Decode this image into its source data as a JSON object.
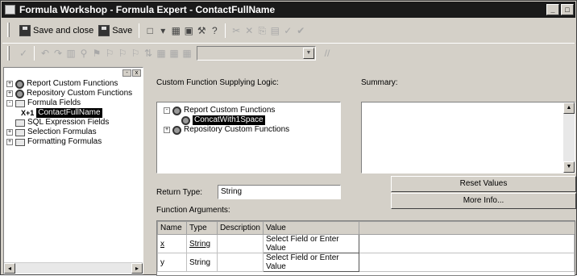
{
  "window": {
    "title": "Formula Workshop - Formula Expert - ContactFullName"
  },
  "toolbar": {
    "save_close_label": "Save and close",
    "save_label": "Save",
    "comment_label": "//"
  },
  "tree": {
    "items": [
      {
        "label": "Report Custom Functions",
        "expander": "+"
      },
      {
        "label": "Repository Custom Functions",
        "expander": "+"
      },
      {
        "label": "Formula Fields",
        "expander": "-"
      },
      {
        "label": "ContactFullName",
        "prefix": "X+1"
      },
      {
        "label": "SQL Expression Fields",
        "expander": ""
      },
      {
        "label": "Selection Formulas",
        "expander": "+"
      },
      {
        "label": "Formatting Formulas",
        "expander": "+"
      }
    ]
  },
  "logic": {
    "label": "Custom Function Supplying Logic:",
    "items": [
      {
        "label": "Report Custom Functions",
        "expander": "-"
      },
      {
        "label": "ConcatWith1Space",
        "expander": ""
      },
      {
        "label": "Repository Custom Functions",
        "expander": "+"
      }
    ]
  },
  "summary": {
    "label": "Summary:"
  },
  "return_type": {
    "label": "Return Type:",
    "value": "String"
  },
  "buttons": {
    "reset": "Reset Values",
    "more_info": "More Info..."
  },
  "args": {
    "label": "Function Arguments:",
    "headers": [
      "Name",
      "Type",
      "Description",
      "Value"
    ],
    "rows": [
      {
        "name": "x",
        "type": "String",
        "description": "",
        "value": "Select Field or Enter Value"
      },
      {
        "name": "y",
        "type": "String",
        "description": "",
        "value": "Select Field or Enter Value"
      }
    ]
  }
}
